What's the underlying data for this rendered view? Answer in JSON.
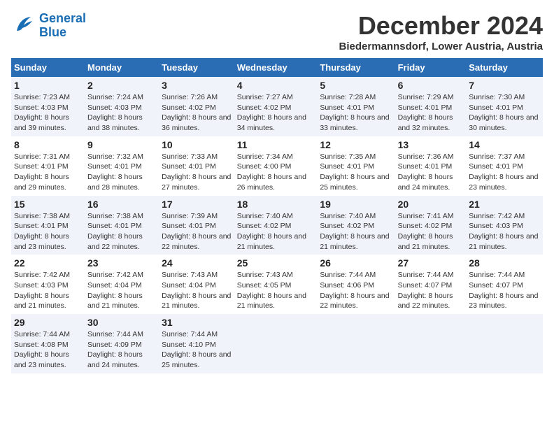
{
  "header": {
    "logo_line1": "General",
    "logo_line2": "Blue",
    "month": "December 2024",
    "location": "Biedermannsdorf, Lower Austria, Austria"
  },
  "weekdays": [
    "Sunday",
    "Monday",
    "Tuesday",
    "Wednesday",
    "Thursday",
    "Friday",
    "Saturday"
  ],
  "weeks": [
    [
      {
        "day": 1,
        "sunrise": "7:23 AM",
        "sunset": "4:03 PM",
        "daylight": "8 hours and 39 minutes."
      },
      {
        "day": 2,
        "sunrise": "7:24 AM",
        "sunset": "4:03 PM",
        "daylight": "8 hours and 38 minutes."
      },
      {
        "day": 3,
        "sunrise": "7:26 AM",
        "sunset": "4:02 PM",
        "daylight": "8 hours and 36 minutes."
      },
      {
        "day": 4,
        "sunrise": "7:27 AM",
        "sunset": "4:02 PM",
        "daylight": "8 hours and 34 minutes."
      },
      {
        "day": 5,
        "sunrise": "7:28 AM",
        "sunset": "4:01 PM",
        "daylight": "8 hours and 33 minutes."
      },
      {
        "day": 6,
        "sunrise": "7:29 AM",
        "sunset": "4:01 PM",
        "daylight": "8 hours and 32 minutes."
      },
      {
        "day": 7,
        "sunrise": "7:30 AM",
        "sunset": "4:01 PM",
        "daylight": "8 hours and 30 minutes."
      }
    ],
    [
      {
        "day": 8,
        "sunrise": "7:31 AM",
        "sunset": "4:01 PM",
        "daylight": "8 hours and 29 minutes."
      },
      {
        "day": 9,
        "sunrise": "7:32 AM",
        "sunset": "4:01 PM",
        "daylight": "8 hours and 28 minutes."
      },
      {
        "day": 10,
        "sunrise": "7:33 AM",
        "sunset": "4:01 PM",
        "daylight": "8 hours and 27 minutes."
      },
      {
        "day": 11,
        "sunrise": "7:34 AM",
        "sunset": "4:00 PM",
        "daylight": "8 hours and 26 minutes."
      },
      {
        "day": 12,
        "sunrise": "7:35 AM",
        "sunset": "4:01 PM",
        "daylight": "8 hours and 25 minutes."
      },
      {
        "day": 13,
        "sunrise": "7:36 AM",
        "sunset": "4:01 PM",
        "daylight": "8 hours and 24 minutes."
      },
      {
        "day": 14,
        "sunrise": "7:37 AM",
        "sunset": "4:01 PM",
        "daylight": "8 hours and 23 minutes."
      }
    ],
    [
      {
        "day": 15,
        "sunrise": "7:38 AM",
        "sunset": "4:01 PM",
        "daylight": "8 hours and 23 minutes."
      },
      {
        "day": 16,
        "sunrise": "7:38 AM",
        "sunset": "4:01 PM",
        "daylight": "8 hours and 22 minutes."
      },
      {
        "day": 17,
        "sunrise": "7:39 AM",
        "sunset": "4:01 PM",
        "daylight": "8 hours and 22 minutes."
      },
      {
        "day": 18,
        "sunrise": "7:40 AM",
        "sunset": "4:02 PM",
        "daylight": "8 hours and 21 minutes."
      },
      {
        "day": 19,
        "sunrise": "7:40 AM",
        "sunset": "4:02 PM",
        "daylight": "8 hours and 21 minutes."
      },
      {
        "day": 20,
        "sunrise": "7:41 AM",
        "sunset": "4:02 PM",
        "daylight": "8 hours and 21 minutes."
      },
      {
        "day": 21,
        "sunrise": "7:42 AM",
        "sunset": "4:03 PM",
        "daylight": "8 hours and 21 minutes."
      }
    ],
    [
      {
        "day": 22,
        "sunrise": "7:42 AM",
        "sunset": "4:03 PM",
        "daylight": "8 hours and 21 minutes."
      },
      {
        "day": 23,
        "sunrise": "7:42 AM",
        "sunset": "4:04 PM",
        "daylight": "8 hours and 21 minutes."
      },
      {
        "day": 24,
        "sunrise": "7:43 AM",
        "sunset": "4:04 PM",
        "daylight": "8 hours and 21 minutes."
      },
      {
        "day": 25,
        "sunrise": "7:43 AM",
        "sunset": "4:05 PM",
        "daylight": "8 hours and 21 minutes."
      },
      {
        "day": 26,
        "sunrise": "7:44 AM",
        "sunset": "4:06 PM",
        "daylight": "8 hours and 22 minutes."
      },
      {
        "day": 27,
        "sunrise": "7:44 AM",
        "sunset": "4:07 PM",
        "daylight": "8 hours and 22 minutes."
      },
      {
        "day": 28,
        "sunrise": "7:44 AM",
        "sunset": "4:07 PM",
        "daylight": "8 hours and 23 minutes."
      }
    ],
    [
      {
        "day": 29,
        "sunrise": "7:44 AM",
        "sunset": "4:08 PM",
        "daylight": "8 hours and 23 minutes."
      },
      {
        "day": 30,
        "sunrise": "7:44 AM",
        "sunset": "4:09 PM",
        "daylight": "8 hours and 24 minutes."
      },
      {
        "day": 31,
        "sunrise": "7:44 AM",
        "sunset": "4:10 PM",
        "daylight": "8 hours and 25 minutes."
      },
      null,
      null,
      null,
      null
    ]
  ]
}
